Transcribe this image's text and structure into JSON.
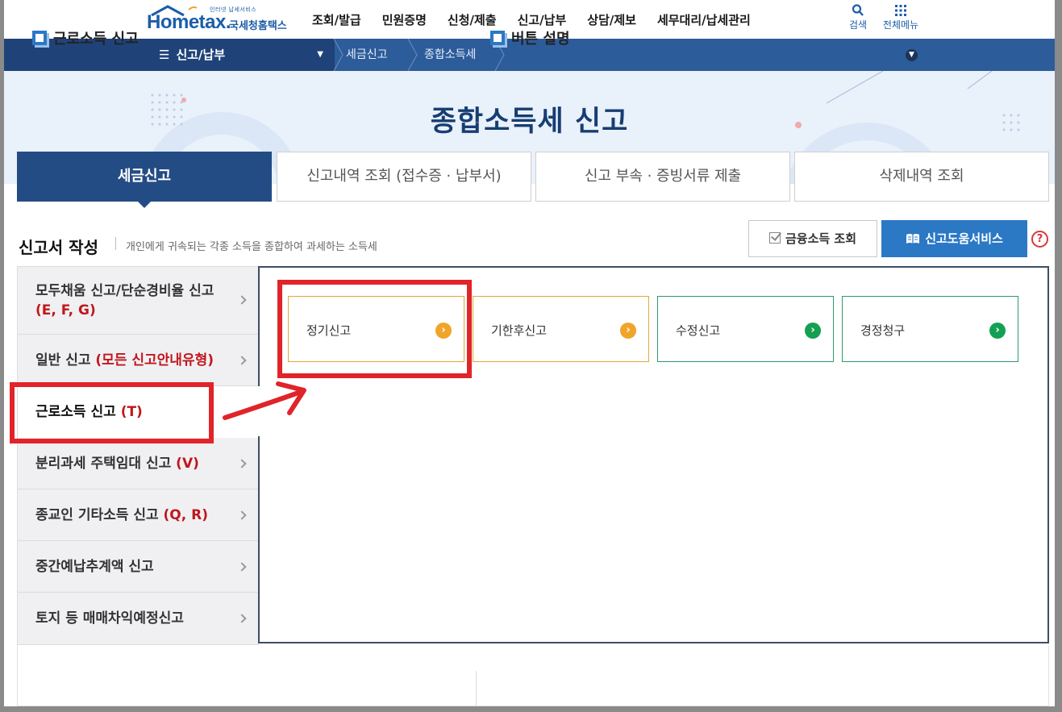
{
  "header": {
    "logo": {
      "tagline": "인터넷 납세서비스",
      "brand": "Hometax.",
      "brand_sub": "국세청홈택스"
    },
    "gnb": [
      "조회/발급",
      "민원증명",
      "신청/제출",
      "신고/납부",
      "상담/제보",
      "세무대리/납세관리"
    ],
    "search_label": "검색",
    "menu_label": "전체메뉴",
    "search_icon": "search-icon",
    "menu_icon": "grid-menu-icon"
  },
  "nav": {
    "main": "신고/납부",
    "crumbs": [
      "세금신고",
      "종합소득세"
    ]
  },
  "banner": {
    "title": "종합소득세 신고"
  },
  "tabs": [
    "세금신고",
    "신고내역 조회 (접수증 · 납부서)",
    "신고 부속 · 증빙서류 제출",
    "삭제내역 조회"
  ],
  "section": {
    "title": "신고서 작성",
    "desc": "개인에게 귀속되는 각종 소득을 종합하여 과세하는 소득세",
    "finance_button": "금융소득 조회",
    "help_button": "신고도움서비스",
    "help_q": "?"
  },
  "left_menu": [
    {
      "label": "모두채움 신고/단순경비율 신고",
      "code": "(E, F, G)"
    },
    {
      "label": "일반 신고",
      "code": "(모든 신고안내유형)"
    },
    {
      "label": "근로소득 신고",
      "code": "(T)"
    },
    {
      "label": "분리과세 주택임대 신고",
      "code": "(V)"
    },
    {
      "label": "종교인 기타소득 신고",
      "code": "(Q, R)"
    },
    {
      "label": "중간예납추계액 신고",
      "code": ""
    },
    {
      "label": "토지 등 매매차익예정신고",
      "code": ""
    }
  ],
  "report_buttons": [
    "정기신고",
    "기한후신고",
    "수정신고",
    "경정청구"
  ],
  "bottom": {
    "left_title": "근로소득 신고",
    "right_title": "버튼 설명"
  },
  "colors": {
    "navy": "#234c84",
    "nav_blue": "#2d5c9a",
    "accent_red": "#c0171c",
    "annotation_red": "#e0242a",
    "orange": "#f0a52a",
    "green": "#13a052",
    "help_blue": "#2b78c5"
  }
}
